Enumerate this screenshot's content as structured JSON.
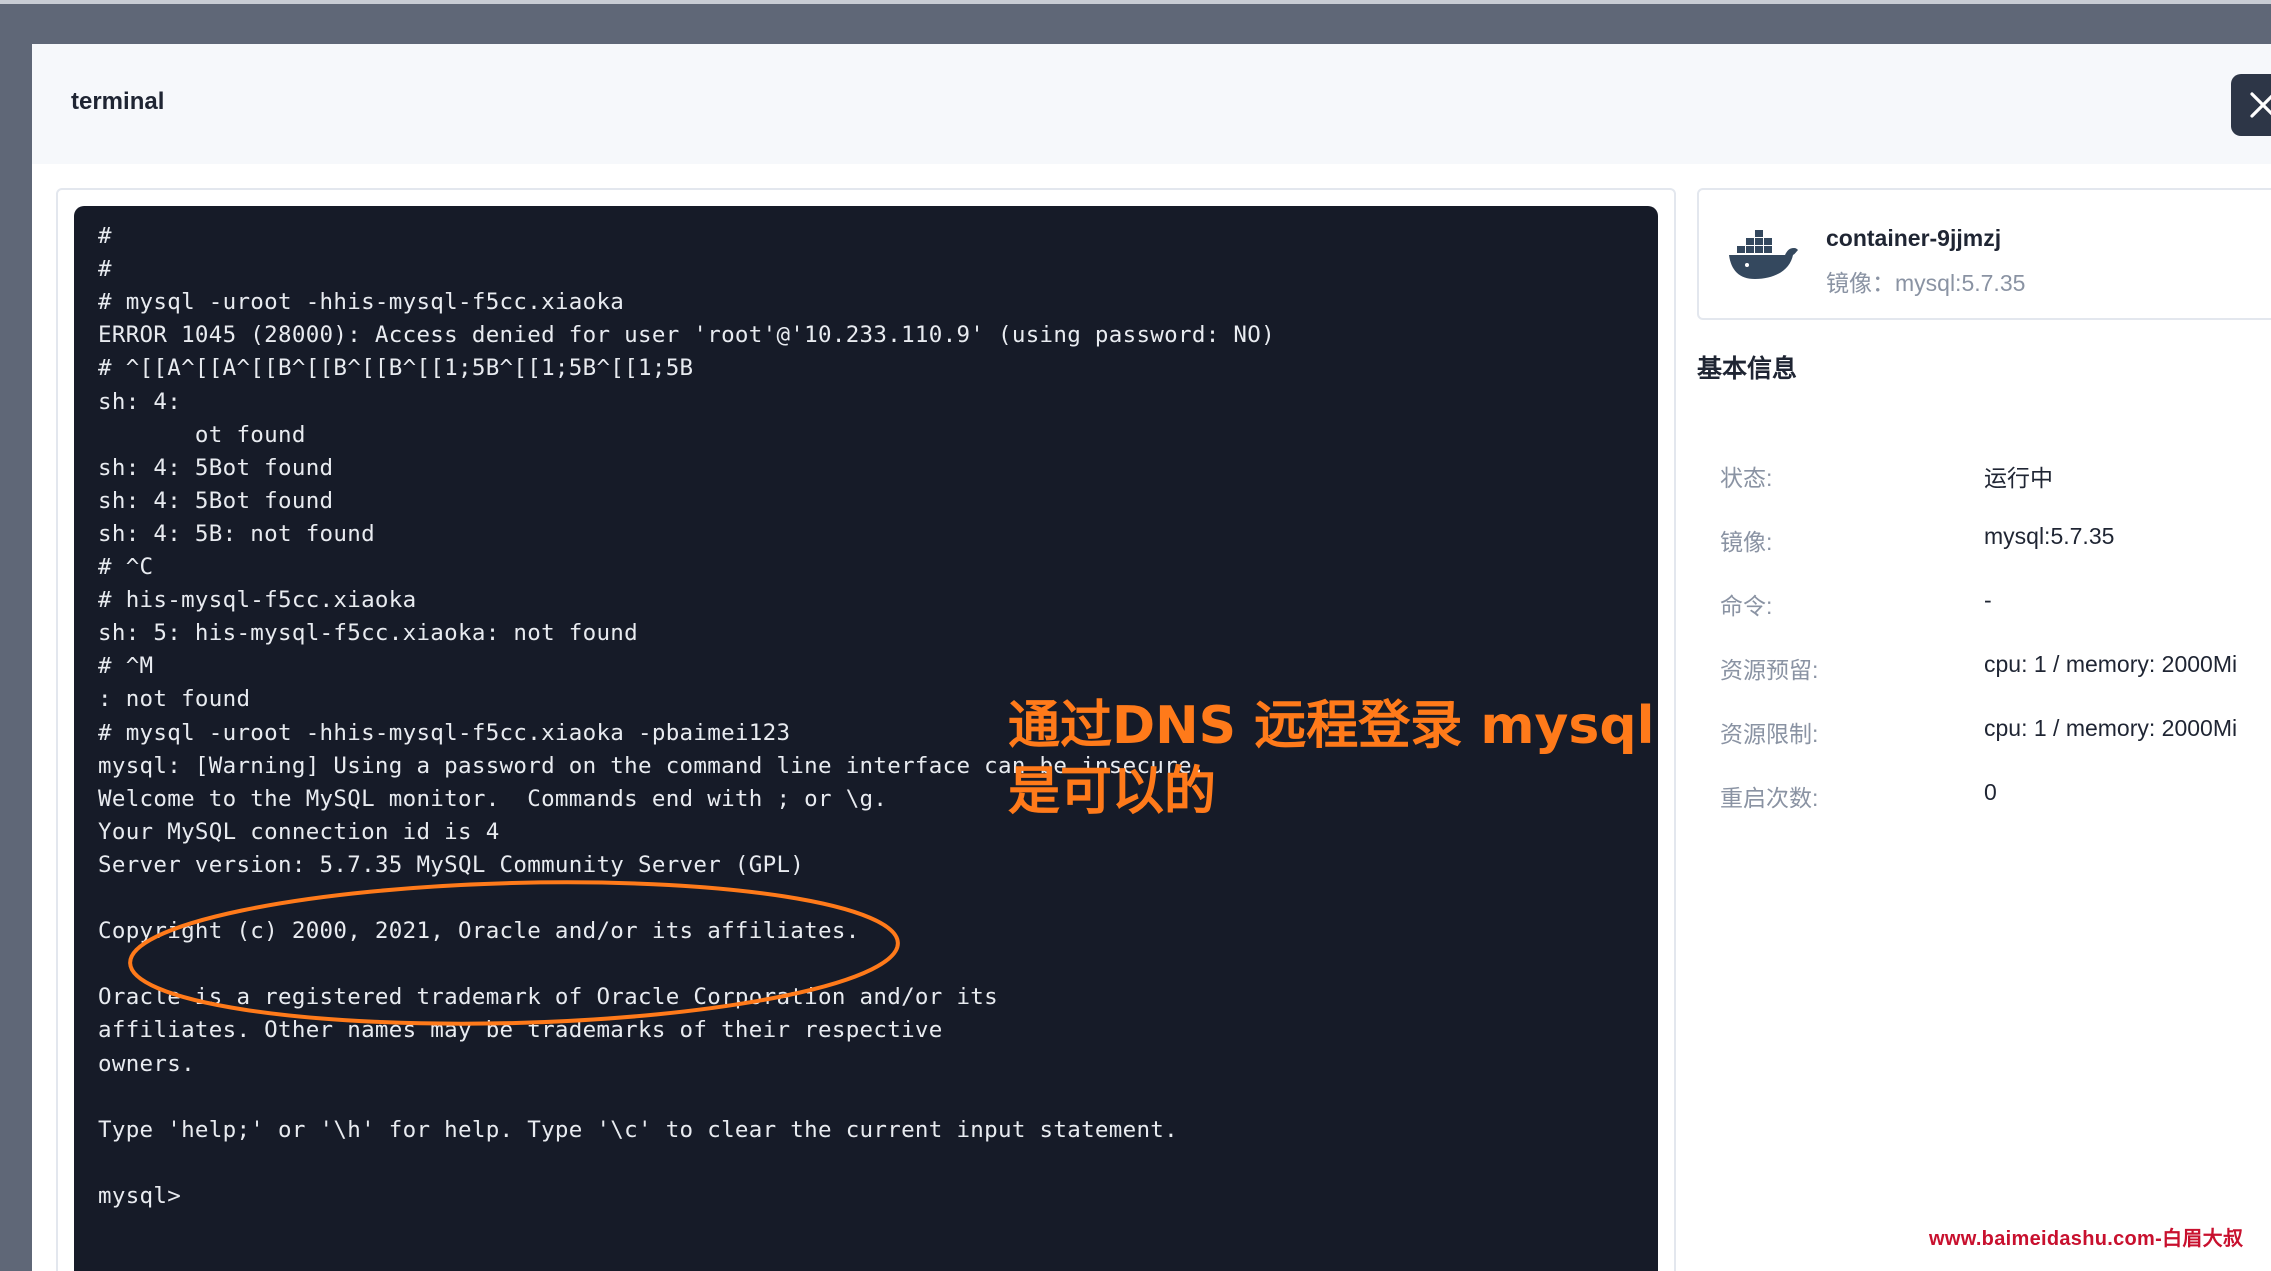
{
  "modal": {
    "title": "terminal",
    "close_icon": "close-icon"
  },
  "terminal": {
    "lines": [
      "#",
      "#",
      "# mysql -uroot -hhis-mysql-f5cc.xiaoka",
      "ERROR 1045 (28000): Access denied for user 'root'@'10.233.110.9' (using password: NO)",
      "# ^[[A^[[A^[[B^[[B^[[B^[[1;5B^[[1;5B^[[1;5B",
      "sh: 4:",
      "       ot found",
      "sh: 4: 5Bot found",
      "sh: 4: 5Bot found",
      "sh: 4: 5B: not found",
      "# ^C",
      "# his-mysql-f5cc.xiaoka",
      "sh: 5: his-mysql-f5cc.xiaoka: not found",
      "# ^M",
      ": not found",
      "# mysql -uroot -hhis-mysql-f5cc.xiaoka -pbaimei123",
      "mysql: [Warning] Using a password on the command line interface can be insecure.",
      "Welcome to the MySQL monitor.  Commands end with ; or \\g.",
      "Your MySQL connection id is 4",
      "Server version: 5.7.35 MySQL Community Server (GPL)",
      "",
      "Copyright (c) 2000, 2021, Oracle and/or its affiliates.",
      "",
      "Oracle is a registered trademark of Oracle Corporation and/or its",
      "affiliates. Other names may be trademarks of their respective",
      "owners.",
      "",
      "Type 'help;' or '\\h' for help. Type '\\c' to clear the current input statement.",
      "",
      "mysql>"
    ],
    "annotation": {
      "line1": "通过DNS 远程登录 mysql",
      "line2": "是可以的",
      "color": "#ff7a1a"
    }
  },
  "container": {
    "icon": "docker-whale-icon",
    "name": "container-9jjmzj",
    "image": "镜像：mysql:5.7.35"
  },
  "basic_info": {
    "title": "基本信息",
    "rows": [
      {
        "label": "状态:",
        "value": "运行中"
      },
      {
        "label": "镜像:",
        "value": "mysql:5.7.35"
      },
      {
        "label": "命令:",
        "value": "-"
      },
      {
        "label": "资源预留:",
        "value": "cpu: 1 / memory: 2000Mi"
      },
      {
        "label": "资源限制:",
        "value": "cpu: 1 / memory: 2000Mi"
      },
      {
        "label": "重启次数:",
        "value": "0"
      }
    ]
  },
  "watermark": "www.baimeidashu.com-白眉大叔"
}
